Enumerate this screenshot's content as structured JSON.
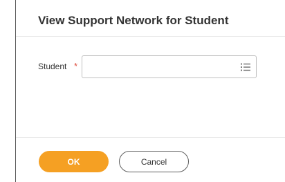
{
  "dialog": {
    "title": "View Support Network for Student"
  },
  "form": {
    "student": {
      "label": "Student",
      "required_mark": "*",
      "value": "",
      "prompt_icon": "list-prompt-icon"
    }
  },
  "footer": {
    "ok_label": "OK",
    "cancel_label": "Cancel"
  },
  "colors": {
    "primary_button": "#f5a023",
    "required": "#de4b3c"
  }
}
